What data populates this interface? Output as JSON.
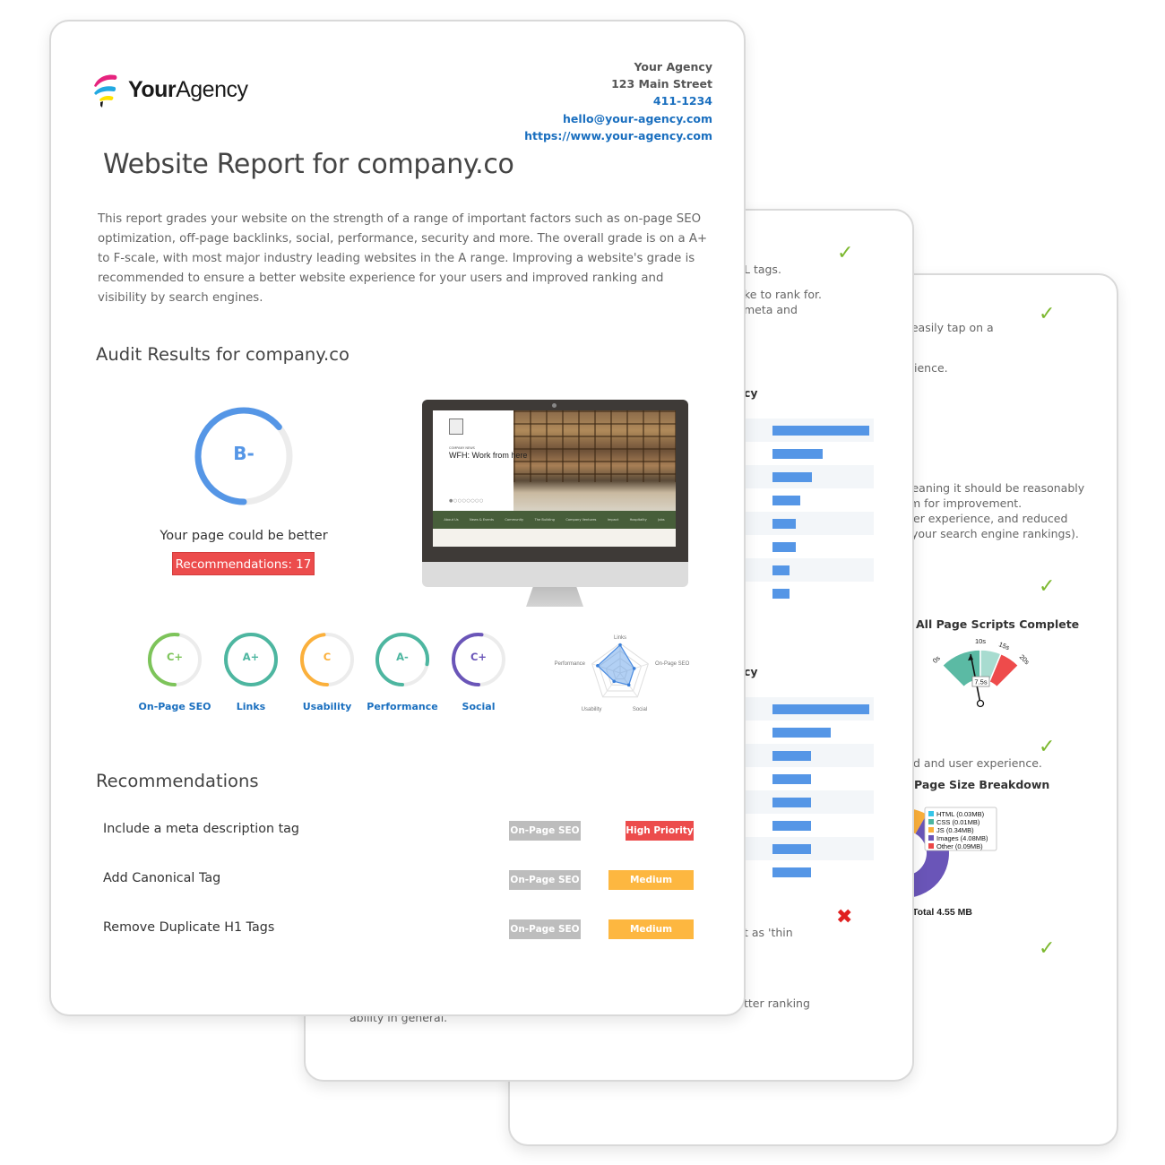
{
  "page3": {
    "fragments": [
      "ɔ easily tap on a",
      "ience.",
      "ıeaning it should be reasonably",
      "m for improvement.",
      "er experience, and reduced",
      "your search engine rankings).",
      "d and user experience."
    ],
    "gauge": {
      "title": "All Page Scripts Complete",
      "value_label": "7.5s",
      "value": 7.5,
      "ticks": [
        "0s",
        "10s",
        "15s",
        "20s"
      ],
      "colors": {
        "good": "#5bbaa4",
        "ok": "#a8dcd0",
        "bad": "#ee4b4b"
      }
    },
    "page_size": {
      "title": "Page Size Breakdown",
      "total_label": "Total 4.55 MB",
      "legend": [
        {
          "label": "HTML (0.03MB)",
          "value": 0.03,
          "color": "#36c5e8"
        },
        {
          "label": "CSS (0.01MB)",
          "value": 0.01,
          "color": "#4db6a0"
        },
        {
          "label": "JS (0.34MB)",
          "value": 0.34,
          "color": "#fbb03b"
        },
        {
          "label": "Images (4.08MB)",
          "value": 4.08,
          "color": "#6a55b8"
        },
        {
          "label": "Other (0.09MB)",
          "value": 0.09,
          "color": "#ec4747"
        }
      ]
    }
  },
  "page2": {
    "fragments": [
      "L tags.",
      "ke to rank for.",
      " meta and",
      "t as 'thin",
      "tter ranking",
      "ability in general."
    ],
    "section_a_heading": "cy",
    "section_b_heading": "cy",
    "bars_a": [
      1.0,
      0.52,
      0.41,
      0.29,
      0.24,
      0.24,
      0.18,
      0.18
    ],
    "bars_b": [
      1.0,
      0.6,
      0.4,
      0.4,
      0.4,
      0.4,
      0.4,
      0.4
    ]
  },
  "page1": {
    "logo": {
      "bold": "Your",
      "regular": "Agency"
    },
    "contact": {
      "name": "Your Agency",
      "street": "123 Main Street",
      "phone": "411-1234",
      "email": "hello@your-agency.com",
      "website": "https://www.your-agency.com"
    },
    "title": "Website Report for company.co",
    "intro": "This report grades your website on the strength of a range of important factors such as on-page SEO optimization, off-page backlinks, social, performance, security and more. The overall grade is on a A+ to F-scale, with most major industry leading websites in the A range. Improving a website's grade is recommended to ensure a better website experience for your users and improved ranking and visibility by search engines.",
    "audit_heading": "Audit Results for company.co",
    "overall": {
      "grade": "B-",
      "score": 0.64,
      "color": "#5596e6",
      "message": "Your page could be better",
      "recommendations_label": "Recommendations: 17"
    },
    "site_preview": {
      "kicker": "COMPANY NEWS",
      "headline": "WFH: Work from here",
      "nav": [
        "About Us",
        "News & Events",
        "Community",
        "The Building",
        "Company Ventures",
        "Impact",
        "Hospitality",
        "Jobs"
      ]
    },
    "categories": [
      {
        "label": "On-Page SEO",
        "grade": "C+",
        "score": 0.52,
        "color": "#7dc45a"
      },
      {
        "label": "Links",
        "grade": "A+",
        "score": 1.0,
        "color": "#4db6a0"
      },
      {
        "label": "Usability",
        "grade": "C",
        "score": 0.48,
        "color": "#fbb03b"
      },
      {
        "label": "Performance",
        "grade": "A-",
        "score": 0.78,
        "color": "#4db6a0"
      },
      {
        "label": "Social",
        "grade": "C+",
        "score": 0.52,
        "color": "#6a55b8"
      }
    ],
    "radar": {
      "axes": [
        "Links",
        "On-Page SEO",
        "Social",
        "Usability",
        "Performance"
      ],
      "values": [
        0.95,
        0.5,
        0.5,
        0.35,
        0.8
      ]
    },
    "recommendations_heading": "Recommendations",
    "recommendations": [
      {
        "title": "Include a meta description tag",
        "category": "On-Page SEO",
        "priority": "High Priority",
        "priority_level": "high"
      },
      {
        "title": "Add Canonical Tag",
        "category": "On-Page SEO",
        "priority": "Medium Priority",
        "priority_level": "medium"
      },
      {
        "title": "Remove Duplicate H1 Tags",
        "category": "On-Page SEO",
        "priority": "Medium Priority",
        "priority_level": "medium"
      }
    ]
  }
}
